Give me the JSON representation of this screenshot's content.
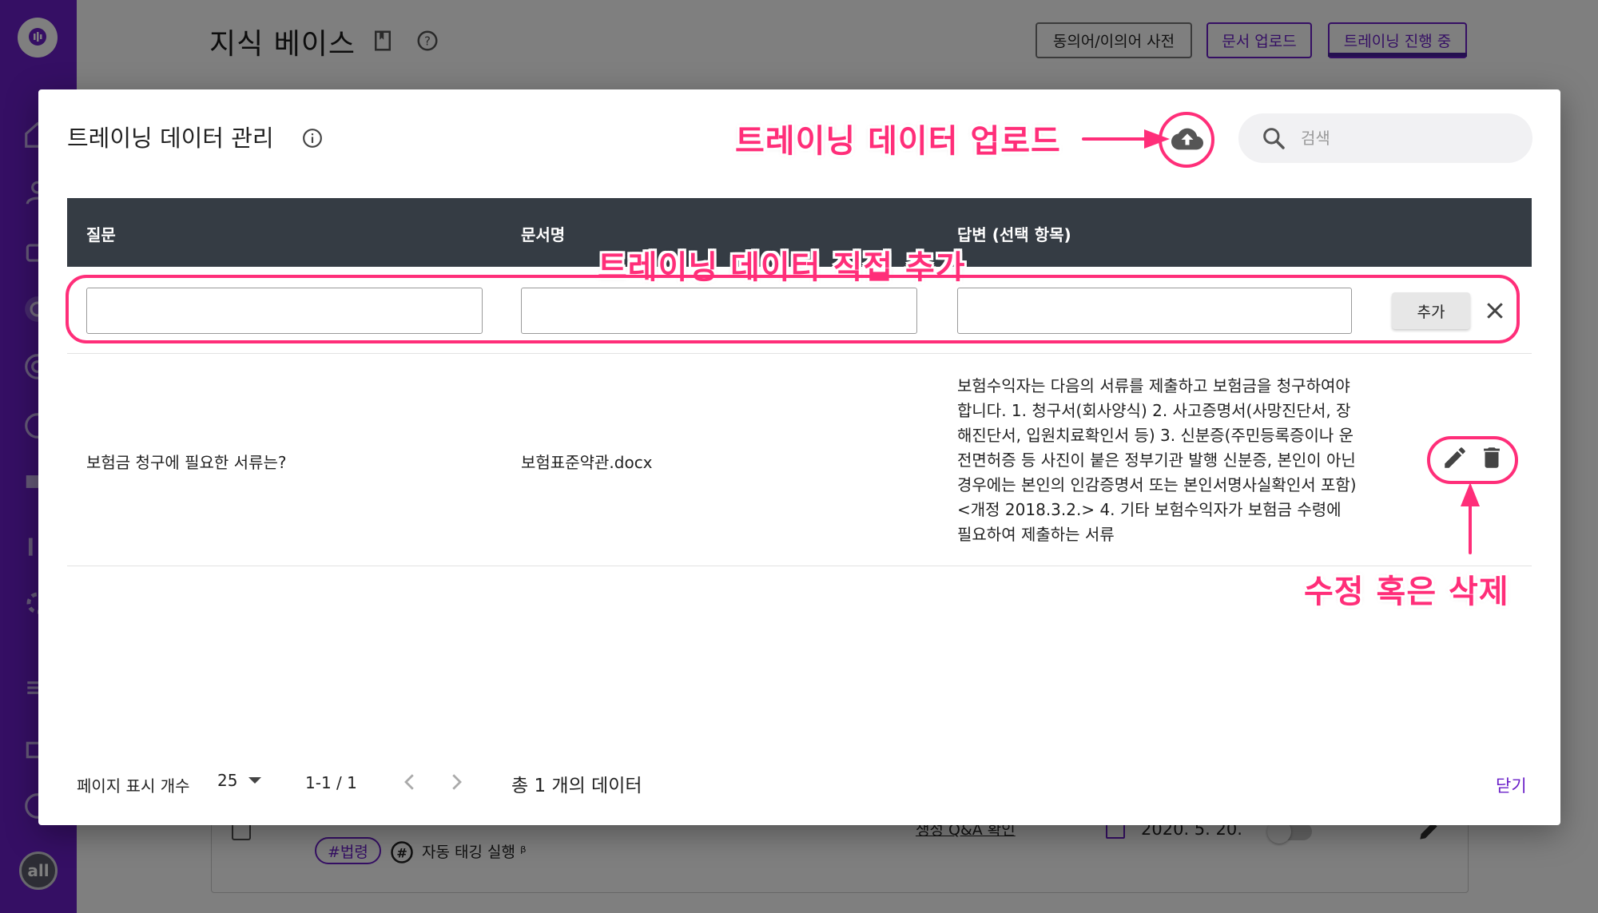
{
  "background": {
    "page_title": "지식 베이스",
    "buttons": {
      "synonym_dict": "동의어/이의어 사전",
      "doc_upload": "문서 업로드",
      "training_in_progress": "트레이닝 진행 중"
    },
    "avatar": "all",
    "card": {
      "tag": "#법령",
      "auto_tag": "자동 태깅 실행 ᵝ",
      "qa_link": "생성 Q&A 확인",
      "date": "2020. 5. 20."
    }
  },
  "modal": {
    "title": "트레이닝 데이터 관리",
    "search_placeholder": "검색",
    "columns": [
      "질문",
      "문서명",
      "답변 (선택 항목)"
    ],
    "add_button": "추가",
    "rows": [
      {
        "question": "보험금 청구에 필요한 서류는?",
        "document": "보험표준약관.docx",
        "answer": "보험수익자는 다음의 서류를 제출하고 보험금을 청구하여야 합니다. 1. 청구서(회사양식) 2. 사고증명서(사망진단서, 장해진단서, 입원치료확인서 등) 3. 신분증(주민등록증이나 운전면허증 등 사진이 붙은 정부기관 발행 신분증, 본인이 아닌 경우에는 본인의 인감증명서 또는 본인서명사실확인서 포함) <개정 2018.3.2.> 4. 기타 보험수익자가 보험금 수령에 필요하여 제출하는 서류"
      }
    ],
    "footer": {
      "rows_per_page_label": "페이지 표시 개수",
      "rows_per_page": "25",
      "range": "1-1 / 1",
      "total": "총 1 개의 데이터",
      "close": "닫기"
    }
  },
  "annotations": {
    "upload": "트레이닝 데이터 업로드",
    "direct_add": "트레이닝 데이터 직접 추가",
    "edit_delete": "수정 혹은 삭제"
  },
  "colors": {
    "brand_purple": "#6a1fc8",
    "table_header": "#353c44",
    "annotation_pink": "#ff2e79"
  }
}
